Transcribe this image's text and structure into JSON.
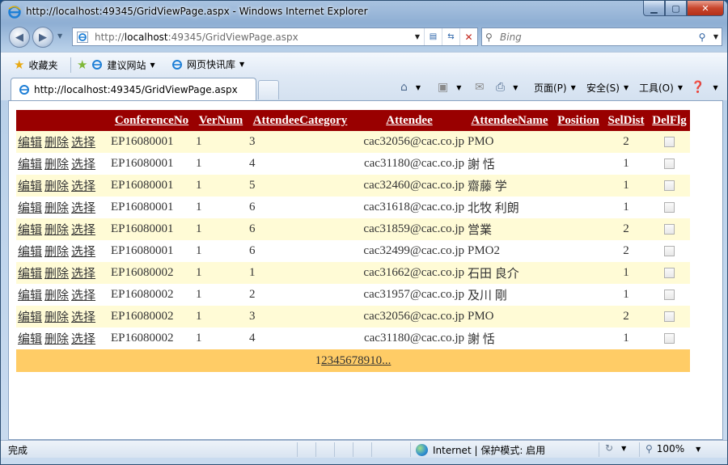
{
  "window": {
    "title": "http://localhost:49345/GridViewPage.aspx - Windows Internet Explorer",
    "min_label": "▁",
    "max_label": "▢",
    "close_label": "✕"
  },
  "address": {
    "url_prefix": "http://",
    "url_host": "localhost",
    "url_rest": ":49345/GridViewPage.aspx"
  },
  "search": {
    "placeholder": "Bing"
  },
  "favorites": {
    "label": "收藏夹",
    "items": [
      "建议网站",
      "网页快讯库"
    ]
  },
  "tabs": [
    {
      "label": "http://localhost:49345/GridViewPage.aspx"
    }
  ],
  "commandbar": {
    "page": "页面(P)",
    "safety": "安全(S)",
    "tools": "工具(O)"
  },
  "grid": {
    "columns": [
      "ConferenceNo",
      "VerNum",
      "AttendeeCategory",
      "Attendee",
      "AttendeeName",
      "Position",
      "SelDist",
      "DelFlg"
    ],
    "actions": [
      "编辑",
      "删除",
      "选择"
    ],
    "rows": [
      {
        "ConferenceNo": "EP16080001",
        "VerNum": "1",
        "AttendeeCategory": "3",
        "Attendee": "cac32056@cac.co.jp",
        "AttendeeName": "PMO",
        "Position": "",
        "SelDist": "2",
        "DelFlg": false
      },
      {
        "ConferenceNo": "EP16080001",
        "VerNum": "1",
        "AttendeeCategory": "4",
        "Attendee": "cac31180@cac.co.jp",
        "AttendeeName": "謝 恬",
        "Position": "",
        "SelDist": "1",
        "DelFlg": false
      },
      {
        "ConferenceNo": "EP16080001",
        "VerNum": "1",
        "AttendeeCategory": "5",
        "Attendee": "cac32460@cac.co.jp",
        "AttendeeName": "齋藤 学",
        "Position": "",
        "SelDist": "1",
        "DelFlg": false
      },
      {
        "ConferenceNo": "EP16080001",
        "VerNum": "1",
        "AttendeeCategory": "6",
        "Attendee": "cac31618@cac.co.jp",
        "AttendeeName": "北牧 利朗",
        "Position": "",
        "SelDist": "1",
        "DelFlg": false
      },
      {
        "ConferenceNo": "EP16080001",
        "VerNum": "1",
        "AttendeeCategory": "6",
        "Attendee": "cac31859@cac.co.jp",
        "AttendeeName": "営業",
        "Position": "",
        "SelDist": "2",
        "DelFlg": false
      },
      {
        "ConferenceNo": "EP16080001",
        "VerNum": "1",
        "AttendeeCategory": "6",
        "Attendee": "cac32499@cac.co.jp",
        "AttendeeName": "PMO2",
        "Position": "",
        "SelDist": "2",
        "DelFlg": false
      },
      {
        "ConferenceNo": "EP16080002",
        "VerNum": "1",
        "AttendeeCategory": "1",
        "Attendee": "cac31662@cac.co.jp",
        "AttendeeName": "石田 良介",
        "Position": "",
        "SelDist": "1",
        "DelFlg": false
      },
      {
        "ConferenceNo": "EP16080002",
        "VerNum": "1",
        "AttendeeCategory": "2",
        "Attendee": "cac31957@cac.co.jp",
        "AttendeeName": "及川 剛",
        "Position": "",
        "SelDist": "1",
        "DelFlg": false
      },
      {
        "ConferenceNo": "EP16080002",
        "VerNum": "1",
        "AttendeeCategory": "3",
        "Attendee": "cac32056@cac.co.jp",
        "AttendeeName": "PMO",
        "Position": "",
        "SelDist": "2",
        "DelFlg": false
      },
      {
        "ConferenceNo": "EP16080002",
        "VerNum": "1",
        "AttendeeCategory": "4",
        "Attendee": "cac31180@cac.co.jp",
        "AttendeeName": "謝 恬",
        "Position": "",
        "SelDist": "1",
        "DelFlg": false
      }
    ],
    "pager": {
      "current": "1",
      "pages": [
        "2",
        "3",
        "4",
        "5",
        "6",
        "7",
        "8",
        "9",
        "10",
        "..."
      ]
    }
  },
  "status": {
    "text": "完成",
    "zone": "Internet | 保护模式: 启用",
    "zoom": "100%"
  },
  "colors": {
    "header_bg": "#990000",
    "row_alt_bg": "#fffbd6",
    "pager_bg": "#ffcc66"
  }
}
